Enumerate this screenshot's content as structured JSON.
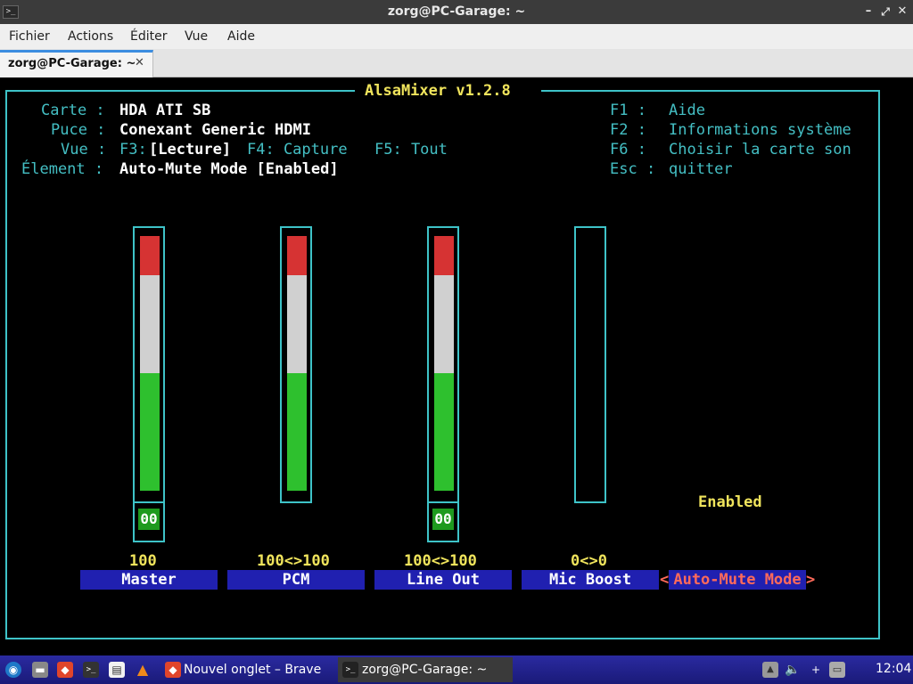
{
  "window": {
    "title": "zorg@PC-Garage: ~",
    "controls": {
      "minimize": "–",
      "maximize": "⤢",
      "close": "✕"
    }
  },
  "menu": {
    "items": [
      "Fichier",
      "Actions",
      "Éditer",
      "Vue",
      "Aide"
    ]
  },
  "tabs": [
    {
      "label": "zorg@PC-Garage: ~",
      "close": "✕"
    }
  ],
  "alsamixer": {
    "header": "AlsaMixer v1.2.8",
    "info": {
      "carte_label": "Carte :",
      "carte_value": "HDA ATI SB",
      "puce_label": "Puce :",
      "puce_value": "Conexant Generic HDMI",
      "vue_label": "Vue :",
      "vue_f3": "F3:",
      "vue_lecture": "[Lecture]",
      "vue_f4": "F4: Capture",
      "vue_f5": "F5: Tout",
      "element_label": "Élement :",
      "element_value": "Auto-Mute Mode [Enabled]"
    },
    "help": [
      {
        "key": "F1 :",
        "text": "Aide"
      },
      {
        "key": "F2 :",
        "text": "Informations système"
      },
      {
        "key": "F6 :",
        "text": "Choisir la carte son"
      },
      {
        "key": "Esc :",
        "text": "quitter"
      }
    ],
    "controls": [
      {
        "name": "Master",
        "value": "100",
        "level_percent": 100,
        "mute": "00"
      },
      {
        "name": "PCM",
        "value": "100<>100",
        "level_percent": 100,
        "mute": ""
      },
      {
        "name": "Line Out",
        "value": "100<>100",
        "level_percent": 100,
        "mute": "00"
      },
      {
        "name": "Mic Boost",
        "value": "0<>0",
        "level_percent": 0,
        "mute": ""
      }
    ],
    "enum_control": {
      "name_left": "<",
      "name": "Auto-Mute Mode",
      "name_right": ">",
      "value": "Enabled"
    },
    "value_sep": "<>"
  },
  "taskbar": {
    "tasks": [
      {
        "label": "Nouvel onglet – Brave"
      },
      {
        "label": "zorg@PC-Garage: ~"
      }
    ],
    "tray_plus": "+",
    "clock": "12:04"
  }
}
